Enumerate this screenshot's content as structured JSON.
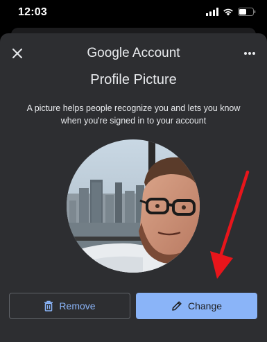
{
  "status_bar": {
    "time": "12:03"
  },
  "header": {
    "brand_google": "Google",
    "brand_account": "Account",
    "close_icon": "close-icon",
    "more_icon": "more-horizontal-icon"
  },
  "main": {
    "title": "Profile Picture",
    "description": "A picture helps people recognize you and lets you know when you're signed in to your account"
  },
  "actions": {
    "remove_label": "Remove",
    "change_label": "Change",
    "remove_icon": "trash-icon",
    "change_icon": "pencil-icon"
  },
  "colors": {
    "sheet_bg": "#2d2e31",
    "accent": "#8ab4f8",
    "annotation_arrow": "#e8151b"
  }
}
